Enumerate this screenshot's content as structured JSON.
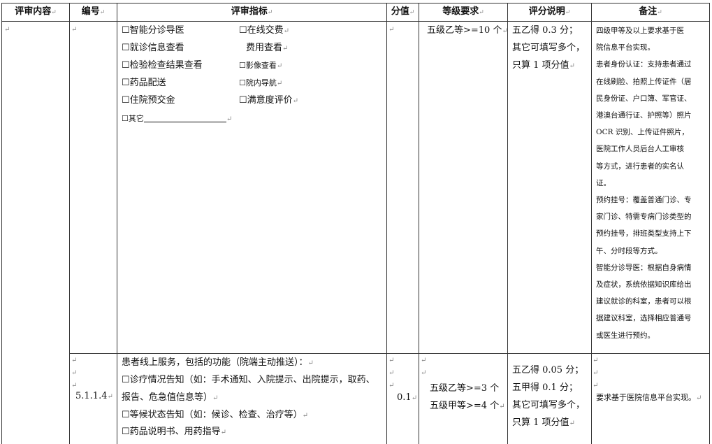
{
  "header": {
    "col1": "评审内容",
    "col2": "编号",
    "col3": "评审指标",
    "col4": "分值",
    "col5": "等级要求",
    "col6": "评分说明",
    "col7": "备注"
  },
  "row1": {
    "indicators_left": [
      "☐智能分诊导医",
      "☐就诊信息查看",
      "☐检验检查结果查看",
      "☐药品配送",
      "☐住院预交金"
    ],
    "indicators_right": [
      "☐在线交费",
      "费用查看",
      "☐影像查看",
      "☐院内导航",
      "☐满意度评价"
    ],
    "other": "☐其它",
    "level": "五级乙等>=10 个",
    "score_lines": [
      "五乙得  0.3 分；",
      "其它可填写多个，",
      "只算 1 项分值"
    ],
    "note_lines": [
      "四级甲等及以上要求基于医",
      "院信息平台实现。",
      "患者身份认证：支持患者通过",
      "在线刷脸、拍照上传证件（居",
      "民身份证、户口簿、军官证、",
      "港澳台通行证、护照等）照片",
      "OCR 识别、上传证件照片，",
      "医院工作人员后台人工审核",
      "等方式，进行患者的实名认",
      "证。",
      "预约挂号：覆盖普通门诊、专",
      "家门诊、特需专病门诊类型的",
      "预约挂号，排班类型支持上下",
      "午、分时段等方式。",
      "智能分诊导医：根据自身病情",
      "及症状，系统依据知识库给出",
      "建议就诊的科室，患者可以根",
      "据建议科室，选择相应普通号",
      "或医生进行预约。"
    ]
  },
  "row2": {
    "code": "5.1.1.4",
    "indicator_lines": [
      "患者线上服务，包括的功能（院端主动推送）：",
      "☐诊疗情况告知（如：手术通知、入院提示、出院提示，取药、",
      "报告、危急值信息等）",
      "☐等候状态告知（如：候诊、检查、治疗等）",
      "☐药品说明书、用药指导"
    ],
    "score": "0.1",
    "level_lines": [
      "五级乙等>=3 个",
      "五级甲等>=4 个"
    ],
    "score_lines": [
      "五乙得  0.05 分；",
      "五甲得  0.1 分；",
      "其它可填写多个，",
      "只算 1 项分值"
    ],
    "note": "要求基于医院信息平台实现。"
  }
}
